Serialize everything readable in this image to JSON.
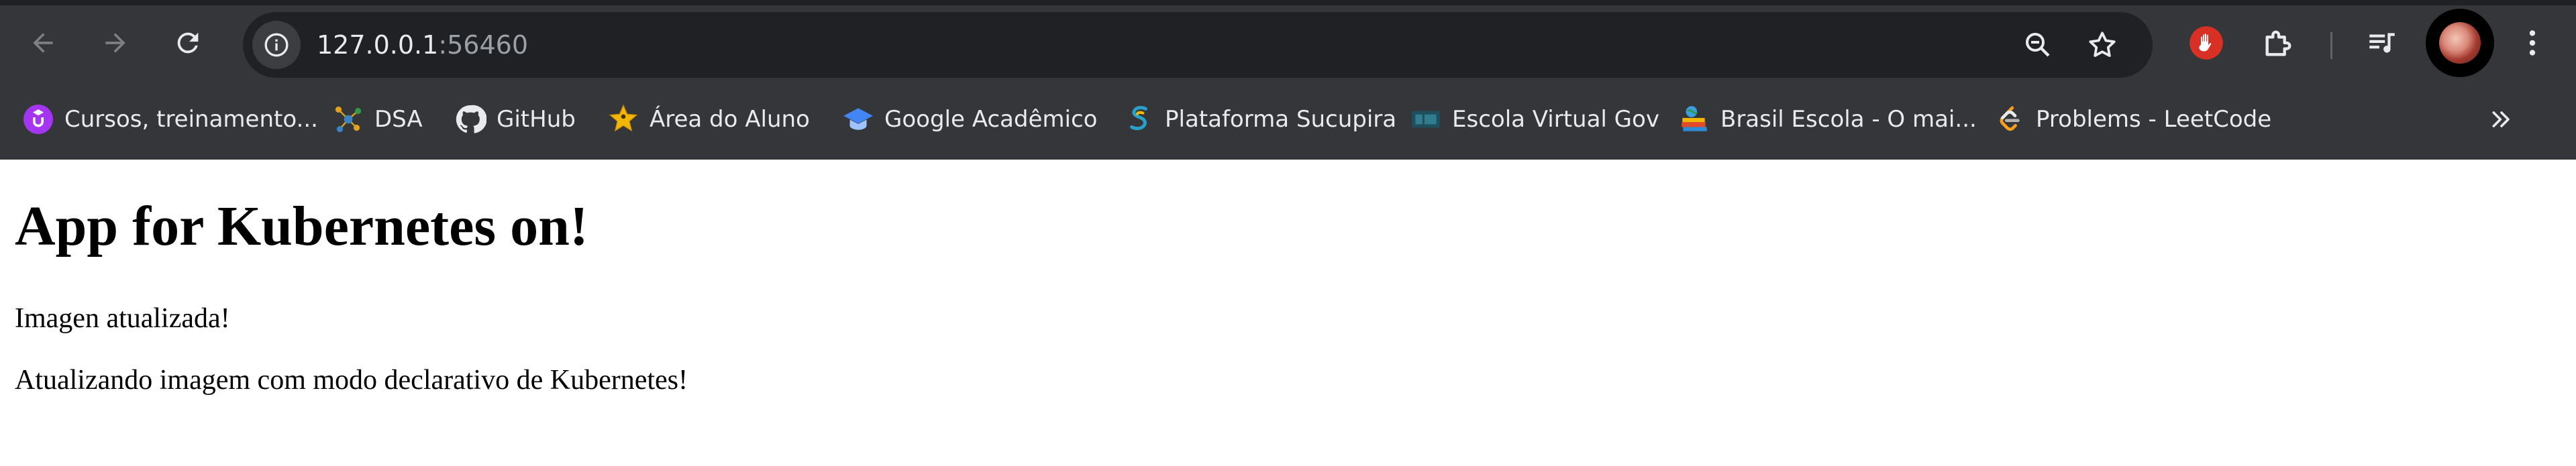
{
  "browser": {
    "url_host": "127.0.0.1",
    "url_port": ":56460",
    "icons": {
      "back": "arrow-left-icon",
      "forward": "arrow-right-icon",
      "reload": "reload-icon",
      "site_info": "info-icon",
      "zoom": "zoom-out-icon",
      "bookmark": "star-icon",
      "extension_1": "red-hand-extension-icon",
      "extensions": "puzzle-piece-icon",
      "media": "playlist-icon",
      "profile": "avatar",
      "menu": "kebab-menu-icon"
    },
    "bookmarks": [
      {
        "label": "Cursos, treinamento...",
        "icon": "udemy-icon"
      },
      {
        "label": "DSA",
        "icon": "dsa-icon"
      },
      {
        "label": "GitHub",
        "icon": "github-icon"
      },
      {
        "label": "Área do Aluno",
        "icon": "star-person-icon"
      },
      {
        "label": "Google Acadêmico",
        "icon": "graduation-cap-icon"
      },
      {
        "label": "Plataforma Sucupira",
        "icon": "sucupira-icon"
      },
      {
        "label": "Escola Virtual Gov",
        "icon": "ev-gov-icon"
      },
      {
        "label": "Brasil Escola - O mai...",
        "icon": "brasil-escola-icon"
      },
      {
        "label": "Problems - LeetCode",
        "icon": "leetcode-icon"
      }
    ],
    "colors": {
      "chrome_bg": "#35363a",
      "omnibox_bg": "#202124",
      "text": "#e8eaed",
      "muted_text": "#9aa0a6"
    }
  },
  "page": {
    "heading": "App for Kubernetes on!",
    "paragraph_1": "Imagen atualizada!",
    "paragraph_2": "Atualizando imagem com modo declarativo de Kubernetes!"
  }
}
